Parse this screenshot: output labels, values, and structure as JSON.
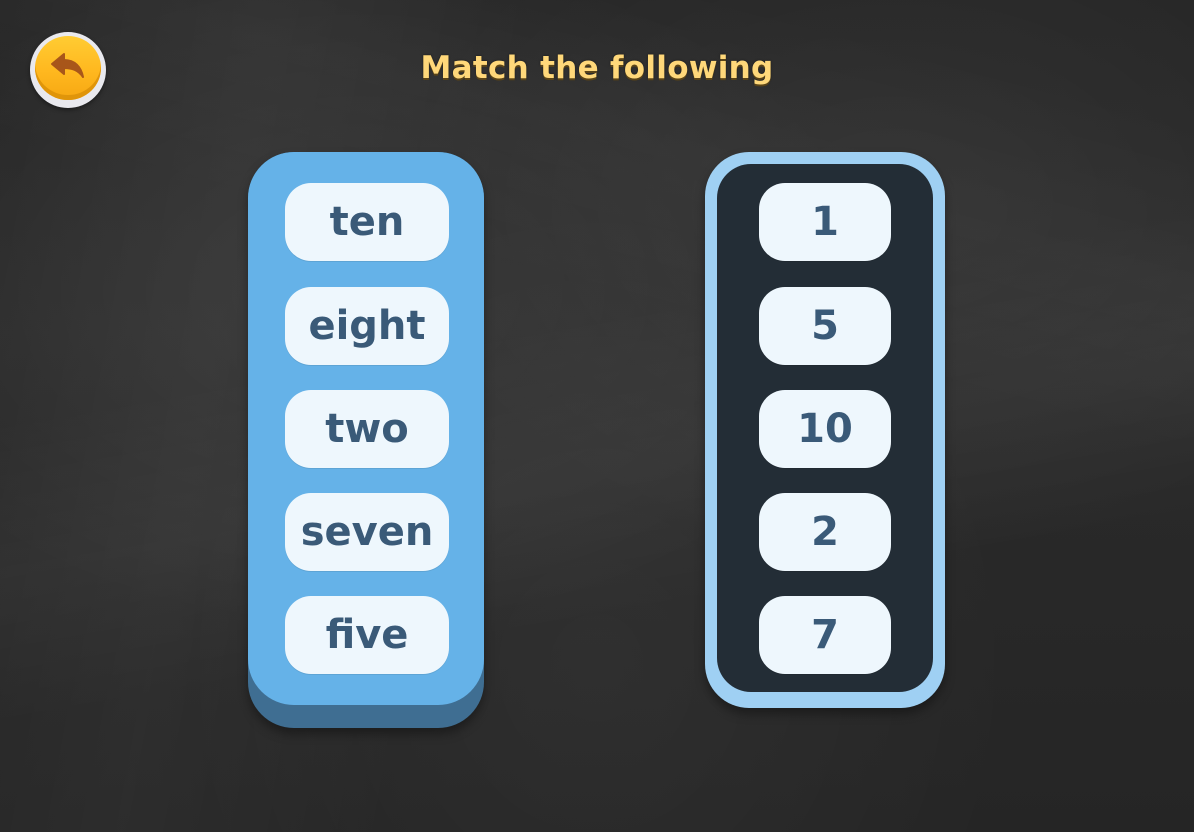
{
  "title": "Match the following",
  "back_button": {
    "icon": "back-arrow-icon"
  },
  "words": [
    "ten",
    "eight",
    "two",
    "seven",
    "five"
  ],
  "numbers": [
    "1",
    "5",
    "10",
    "2",
    "7"
  ],
  "colors": {
    "title": "#ffd87a",
    "word_column": "#65b2e8",
    "number_column_border": "#9fd0f3",
    "number_column_fill": "#232d36",
    "card_bg": "#eef7fd",
    "card_text": "#3a5a78",
    "back_button": "#ffb81f"
  }
}
